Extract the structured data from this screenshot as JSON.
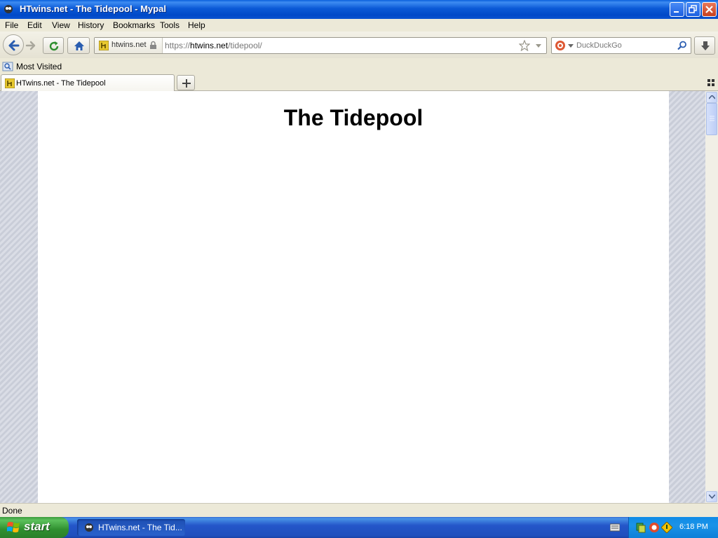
{
  "window": {
    "title": "HTwins.net - The Tidepool - Mypal",
    "controls": [
      "minimize",
      "restore",
      "close"
    ]
  },
  "menu": {
    "items": [
      "File",
      "Edit",
      "View",
      "History",
      "Bookmarks",
      "Tools",
      "Help"
    ]
  },
  "toolbar": {
    "buttons": [
      "back",
      "forward",
      "reload",
      "home",
      "downloads"
    ]
  },
  "urlbar": {
    "identity": "htwins.net",
    "url_prefix": "https://",
    "url_host": "htwins.net",
    "url_path": "/tidepool/"
  },
  "search": {
    "engine": "DuckDuckGo",
    "placeholder": "DuckDuckGo"
  },
  "bookmarks": {
    "items": [
      "Most Visited"
    ]
  },
  "tabs": [
    {
      "label": "HTwins.net - The Tidepool",
      "active": true
    }
  ],
  "page": {
    "heading": "The Tidepool"
  },
  "status": {
    "text": "Done"
  },
  "taskbar": {
    "start_label": "start",
    "task_label": "HTwins.net - The Tid...",
    "clock": "6:18 PM"
  },
  "colors": {
    "titlebar": "#0a52d0",
    "taskbar": "#245edb",
    "start": "#3c9a3c",
    "page_bg": "#ffffff"
  }
}
